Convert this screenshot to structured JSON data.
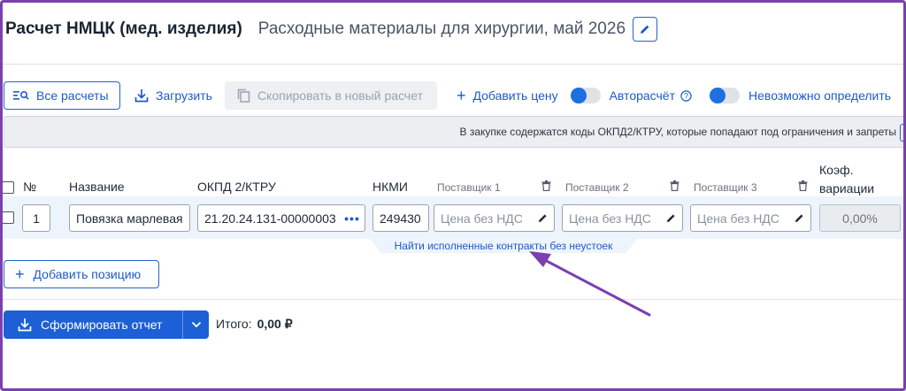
{
  "header": {
    "title": "Расчет НМЦК (мед. изделия)",
    "subtitle": "Расходные материалы для хирургии, май 2026"
  },
  "toolbar": {
    "all_calcs": "Все расчеты",
    "upload": "Загрузить",
    "copy": "Скопировать в новый расчет",
    "add_price": "Добавить цену",
    "autocalc": "Авторасчёт",
    "cannot_determine": "Невозможно определить"
  },
  "warning": "В закупке содержатся коды ОКПД2/КТРУ, которые попадают под ограничения и запреты",
  "table": {
    "headers": {
      "num": "№",
      "name": "Название",
      "okpd": "ОКПД 2/КТРУ",
      "nkmi": "НКМИ",
      "supplier1": "Поставщик 1",
      "supplier2": "Поставщик 2",
      "supplier3": "Поставщик 3",
      "coef_line1": "Коэф.",
      "coef_line2": "вариации"
    },
    "row": {
      "num": "1",
      "name": "Повязка марлевая",
      "okpd": "21.20.24.131-00000003",
      "nkmi": "249430",
      "price_placeholder": "Цена без НДС",
      "coef": "0,00%"
    }
  },
  "find_contracts": "Найти исполненные контракты без неустоек",
  "add_position": "Добавить позицию",
  "report_button": "Сформировать отчет",
  "total_label": "Итого:",
  "total_value": "0,00 ₽",
  "colors": {
    "accent": "#1d5fd6",
    "annotation_arrow": "#7b3fb0"
  }
}
